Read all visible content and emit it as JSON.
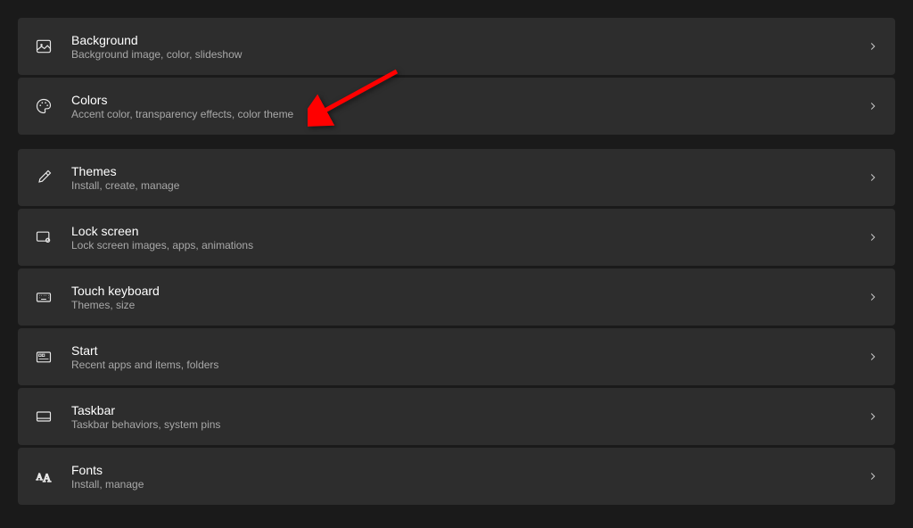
{
  "items": [
    {
      "id": "background",
      "title": "Background",
      "desc": "Background image, color, slideshow"
    },
    {
      "id": "colors",
      "title": "Colors",
      "desc": "Accent color, transparency effects, color theme"
    },
    {
      "id": "themes",
      "title": "Themes",
      "desc": "Install, create, manage"
    },
    {
      "id": "lockscreen",
      "title": "Lock screen",
      "desc": "Lock screen images, apps, animations"
    },
    {
      "id": "touchkeyboard",
      "title": "Touch keyboard",
      "desc": "Themes, size"
    },
    {
      "id": "start",
      "title": "Start",
      "desc": "Recent apps and items, folders"
    },
    {
      "id": "taskbar",
      "title": "Taskbar",
      "desc": "Taskbar behaviors, system pins"
    },
    {
      "id": "fonts",
      "title": "Fonts",
      "desc": "Install, manage"
    }
  ],
  "annotation": {
    "type": "arrow",
    "color": "#ff0000",
    "target": "colors"
  }
}
